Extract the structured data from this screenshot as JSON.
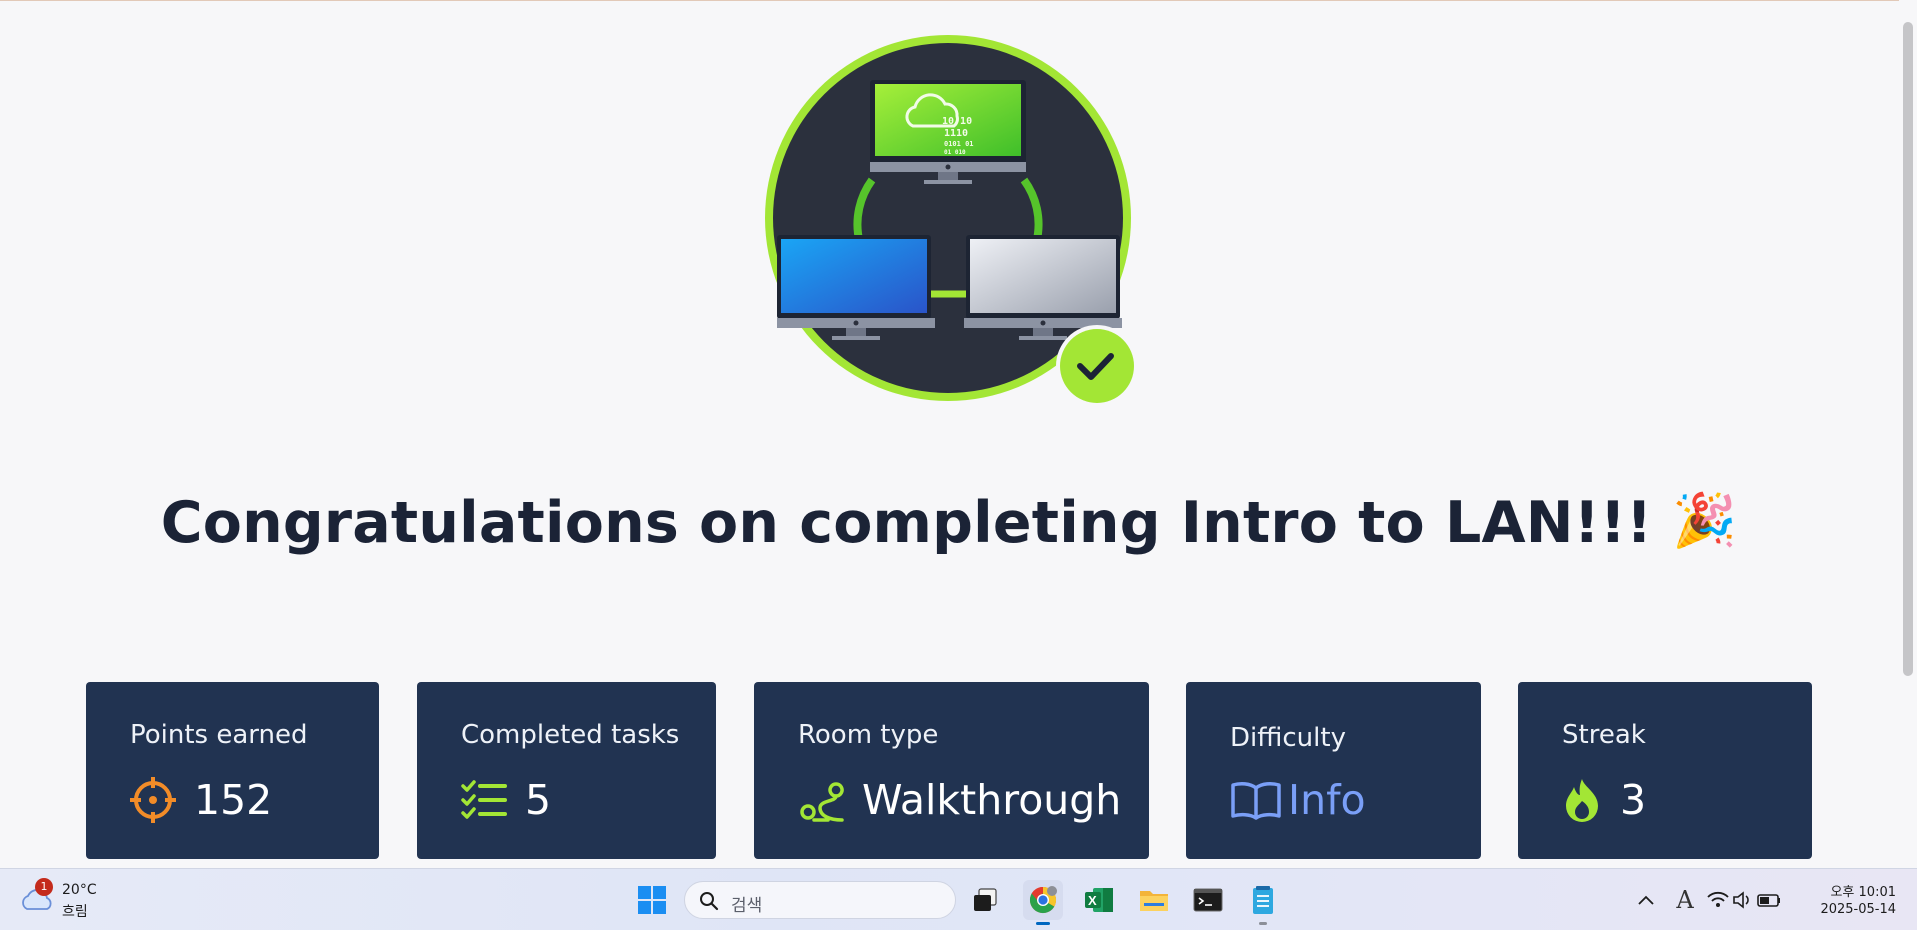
{
  "page": {
    "headline": "Congratulations on completing Intro to LAN!!!",
    "headline_emoji": "🎉",
    "accent_color": "#a3e635",
    "card_bg": "#213351"
  },
  "hero": {
    "icon": "network-computers-illustration",
    "badge_icon": "checkmark-icon",
    "screen_binary": [
      "10 10",
      "1110",
      "0101 01",
      "01  010"
    ]
  },
  "stats": [
    {
      "label": "Points earned",
      "value": "152",
      "icon": "target-icon"
    },
    {
      "label": "Completed tasks",
      "value": "5",
      "icon": "checklist-icon"
    },
    {
      "label": "Room type",
      "value": "Walkthrough",
      "icon": "route-icon"
    },
    {
      "label": "Difficulty",
      "value": "Info",
      "icon": "book-icon"
    },
    {
      "label": "Streak",
      "value": "3",
      "icon": "flame-icon"
    }
  ],
  "taskbar": {
    "weather": {
      "temp": "20°C",
      "condition": "흐림",
      "badge": "1",
      "icon": "cloud-icon"
    },
    "search_placeholder": "검색",
    "apps": [
      "windows-start-icon",
      "task-view-icon",
      "chrome-icon",
      "excel-icon",
      "file-explorer-icon",
      "terminal-icon",
      "notepad-icon"
    ],
    "tray": {
      "time": "오후 10:01",
      "date": "2025-05-14",
      "ime": "A"
    }
  }
}
